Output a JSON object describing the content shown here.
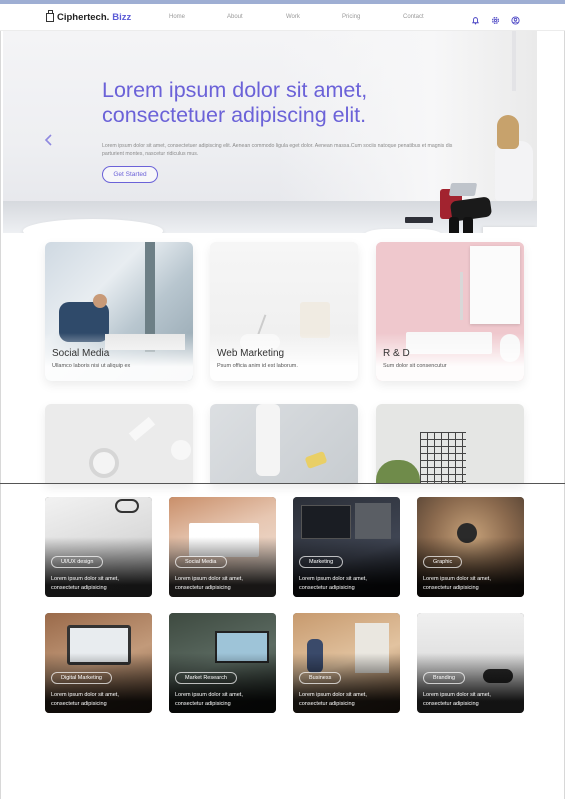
{
  "brand": {
    "name": "Ciphertech.",
    "accent": "Bizz",
    "accent_color": "#5b5bd6"
  },
  "nav": {
    "links": [
      "Home",
      "About",
      "Work",
      "Pricing",
      "Contact"
    ],
    "icons": [
      "bell-icon",
      "gear-icon",
      "user-circle-icon"
    ]
  },
  "hero": {
    "title_line1": "Lorem ipsum dolor sit amet,",
    "title_line2": "consectetuer adipiscing elit.",
    "description": "Lorem ipsum dolor sit amet, consectetuer adipiscing elit. Aenean commodo ligula eget dolor. Aenean massa.Cum sociis natoque penatibus et magnis dis parturient montes, nascetur ridiculus mus.",
    "cta": "Get Started",
    "title_color": "#6b62d8"
  },
  "services": [
    {
      "title": "Social Media",
      "subtitle": "Ullamco laboris nisi ut aliquip ex"
    },
    {
      "title": "Web Marketing",
      "subtitle": "Psum officia anim id est laborum."
    },
    {
      "title": "R & D",
      "subtitle": "Sum dolor sit consencutur"
    }
  ],
  "portfolio": [
    {
      "tag": "UI/UX design",
      "caption": "Lorem ipsum dolor sit amet, consectetur adipisicing"
    },
    {
      "tag": "Social Media",
      "caption": "Lorem ipsum dolor sit amet, consectetur adipisicing"
    },
    {
      "tag": "Marketing",
      "caption": "Lorem ipsum dolor sit amet, consectetur adipisicing"
    },
    {
      "tag": "Graphic",
      "caption": "Lorem ipsum dolor sit amet, consectetur adipisicing"
    },
    {
      "tag": "Digital Marketing",
      "caption": "Lorem ipsum dolor sit amet, consectetur adipisicing"
    },
    {
      "tag": "Market Research",
      "caption": "Lorem ipsum dolor sit amet, consectetur adipisicing"
    },
    {
      "tag": "Business",
      "caption": "Lorem ipsum dolor sit amet, consectetur adipisicing"
    },
    {
      "tag": "Branding",
      "caption": "Lorem ipsum dolor sit amet, consectetur adipisicing"
    }
  ]
}
